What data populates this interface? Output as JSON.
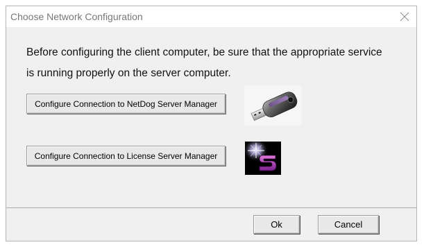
{
  "dialog": {
    "title": "Choose Network Configuration",
    "close_icon": "close-icon"
  },
  "main": {
    "instruction_line1": "Before configuring the client computer, be sure that the appropriate service",
    "instruction_line2": "is running properly on the server computer.",
    "netdog_button_label": "Configure Connection to NetDog Server Manager",
    "netdog_icon": "usb-dongle-icon",
    "license_button_label": "Configure Connection to License Server Manager",
    "license_icon": "license-server-icon"
  },
  "footer": {
    "ok_label": "Ok",
    "cancel_label": "Cancel"
  },
  "colors": {
    "dialog_bg": "#f0f0f0",
    "titlebar_bg": "#ffffff",
    "title_text": "#777777"
  }
}
